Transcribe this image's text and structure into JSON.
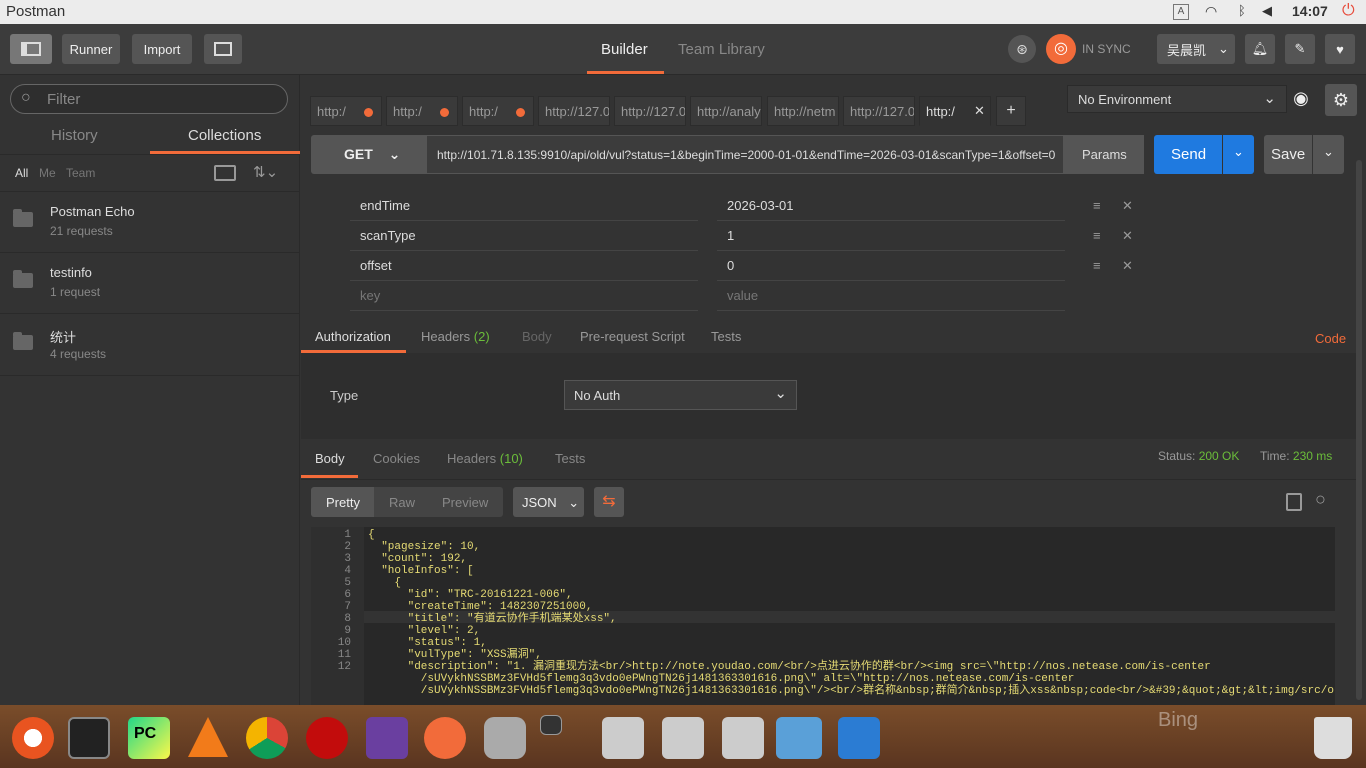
{
  "os": {
    "app_title": "Postman",
    "clock": "14:07"
  },
  "toolbar": {
    "runner": "Runner",
    "import": "Import",
    "builder": "Builder",
    "team_library": "Team Library",
    "sync": "IN SYNC",
    "user": "吴晨凯"
  },
  "sidebar": {
    "filter_placeholder": "Filter",
    "tab_history": "History",
    "tab_collections": "Collections",
    "filter_all": "All",
    "filter_me": "Me",
    "filter_team": "Team",
    "collections": [
      {
        "name": "Postman Echo",
        "count": "21 requests"
      },
      {
        "name": "testinfo",
        "count": "1 request"
      },
      {
        "name": "统计",
        "count": "4 requests"
      }
    ]
  },
  "tabs": [
    "http:/​",
    "http:/​",
    "http:/​",
    "http://127.0",
    "http://127.0",
    "http://analy",
    "http://netm",
    "http://127.0",
    "http:/​"
  ],
  "request": {
    "method": "GET",
    "url": "http://101.71.8.135:9910/api/old/vul?status=1&beginTime=2000-01-01&endTime=2026-03-01&scanType=1&offset=0",
    "params": "Params",
    "send": "Send",
    "save": "Save"
  },
  "params": [
    {
      "key": "endTime",
      "value": "2026-03-01"
    },
    {
      "key": "scanType",
      "value": "1"
    },
    {
      "key": "offset",
      "value": "0"
    }
  ],
  "param_placeholders": {
    "key": "key",
    "value": "value"
  },
  "req_tabs": {
    "authorization": "Authorization",
    "headers": "Headers",
    "headers_count": "(2)",
    "body": "Body",
    "prerequest": "Pre-request Script",
    "tests": "Tests",
    "code": "Code"
  },
  "auth": {
    "type_label": "Type",
    "type_value": "No Auth"
  },
  "env": {
    "selected": "No Environment"
  },
  "resp_tabs": {
    "body": "Body",
    "cookies": "Cookies",
    "headers": "Headers",
    "headers_count": "(10)",
    "tests": "Tests",
    "status_label": "Status:",
    "status": "200 OK",
    "time_label": "Time:",
    "time": "230 ms"
  },
  "resp_view": {
    "pretty": "Pretty",
    "raw": "Raw",
    "preview": "Preview",
    "format": "JSON"
  },
  "code_lines": [
    {
      "n": "1",
      "t": "{"
    },
    {
      "n": "2",
      "t": "  \"pagesize\": 10,"
    },
    {
      "n": "3",
      "t": "  \"count\": 192,"
    },
    {
      "n": "4",
      "t": "  \"holeInfos\": ["
    },
    {
      "n": "5",
      "t": "    {"
    },
    {
      "n": "6",
      "t": "      \"id\": \"TRC-20161221-006\","
    },
    {
      "n": "7",
      "t": "      \"createTime\": 1482307251000,"
    },
    {
      "n": "8",
      "t": "      \"title\": \"有道云协作手机端某处xss\","
    },
    {
      "n": "9",
      "t": "      \"level\": 2,"
    },
    {
      "n": "10",
      "t": "      \"status\": 1,"
    },
    {
      "n": "11",
      "t": "      \"vulType\": \"XSS漏洞\","
    },
    {
      "n": "12",
      "t": "      \"description\": \"1. 漏洞重现方法<br/>http://note.youdao.com/<br/>点进云协作的群<br/><img src=\\\"http://nos.netease.com/is-center"
    },
    {
      "n": "",
      "t": "        /sUVykhNSSBMz3FVHd5flemg3q3vdo0ePWngTN26j1481363301616.png\\\" alt=\\\"http://nos.netease.com/is-center"
    },
    {
      "n": "",
      "t": "        /sUVykhNSSBMz3FVHd5flemg3q3vdo0ePWngTN26j1481363301616.png\\\"/><br/>群名称&nbsp;群简介&nbsp;插入xss&nbsp;code<br/>&#39;&quot;&gt;&lt;img/src/onerror"
    }
  ],
  "dock": {
    "bing": "Bing"
  }
}
